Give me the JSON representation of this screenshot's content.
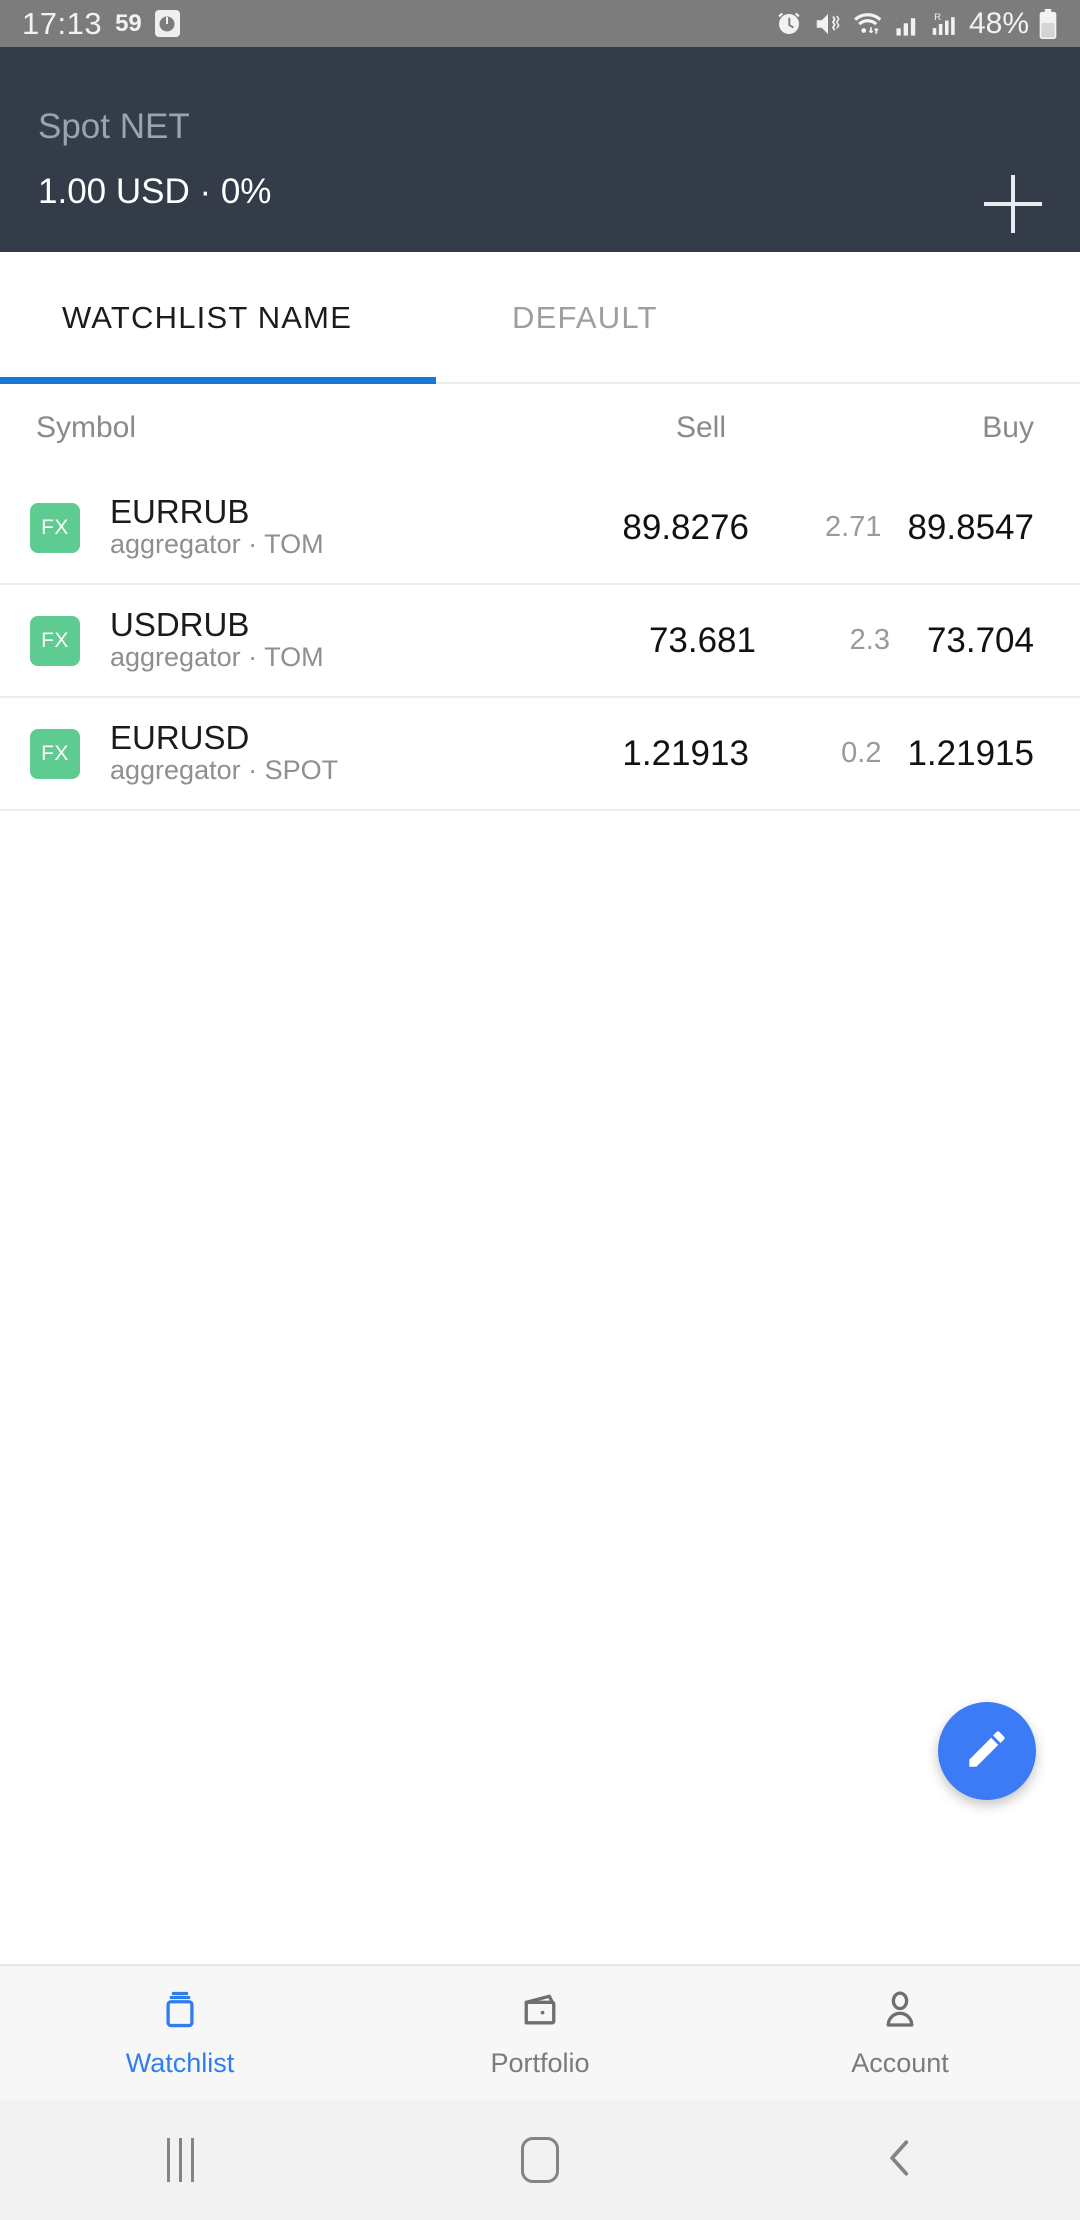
{
  "status_bar": {
    "time": "17:13",
    "notification_badge": "59",
    "battery_percent": "48%",
    "icons": [
      "clock-app-icon",
      "alarm-icon",
      "mute-vibrate-icon",
      "wifi-icon",
      "signal-bars-icon",
      "roaming-signal-icon",
      "battery-icon"
    ]
  },
  "header": {
    "title": "Spot NET",
    "subtitle": "1.00 USD · 0%",
    "add_icon": "plus-icon"
  },
  "tabs": [
    {
      "label": "WATCHLIST NAME",
      "active": true
    },
    {
      "label": "DEFAULT",
      "active": false
    }
  ],
  "table": {
    "columns": {
      "symbol": "Symbol",
      "sell": "Sell",
      "buy": "Buy"
    },
    "rows": [
      {
        "badge": "FX",
        "symbol": "EURRUB",
        "meta": "aggregator · TOM",
        "sell": "89.8276",
        "spread": "2.71",
        "buy": "89.8547"
      },
      {
        "badge": "FX",
        "symbol": "USDRUB",
        "meta": "aggregator · TOM",
        "sell": "73.681",
        "spread": "2.3",
        "buy": "73.704"
      },
      {
        "badge": "FX",
        "symbol": "EURUSD",
        "meta": "aggregator · SPOT",
        "sell": "1.21913",
        "spread": "0.2",
        "buy": "1.21915"
      }
    ]
  },
  "fab": {
    "icon": "pencil-edit-icon"
  },
  "bottom_nav": [
    {
      "label": "Watchlist",
      "icon": "watchlist-icon",
      "active": true
    },
    {
      "label": "Portfolio",
      "icon": "wallet-icon",
      "active": false
    },
    {
      "label": "Account",
      "icon": "person-icon",
      "active": false
    }
  ],
  "system_nav": [
    {
      "icon": "recents-icon"
    },
    {
      "icon": "home-icon"
    },
    {
      "icon": "back-icon"
    }
  ],
  "colors": {
    "header_bg": "#343b49",
    "accent_blue": "#1877d2",
    "fab_blue": "#3b7bf5",
    "badge_green": "#5ecb91"
  }
}
